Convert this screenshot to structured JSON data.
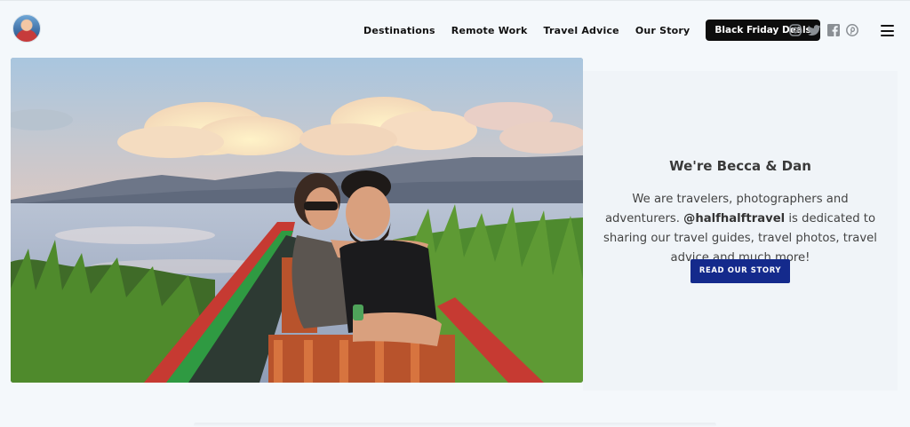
{
  "header": {
    "logo_icon": "avatar-logo-icon",
    "nav": [
      {
        "label": "Destinations"
      },
      {
        "label": "Remote Work"
      },
      {
        "label": "Travel Advice"
      },
      {
        "label": "Our Story"
      }
    ],
    "deals_label": "Black Friday Deals",
    "socials": [
      "instagram-icon",
      "twitter-icon",
      "facebook-icon",
      "pinterest-icon"
    ],
    "menu_icon": "hamburger-menu-icon"
  },
  "hero": {
    "photo": "couple-in-boat-on-lake-photo"
  },
  "about": {
    "title": "We're Becca & Dan",
    "text_before": "We are travelers, photographers and adventurers.",
    "handle": "@halfhalftravel",
    "text_after": " is dedicated to sharing our travel guides, travel photos, travel advice and much more!",
    "button_label": "READ OUR STORY"
  },
  "colors": {
    "page_bg": "#f4f8fb",
    "card_bg": "#f0f4f8",
    "button_dark": "#0d0d0d",
    "button_blue": "#142a8c"
  }
}
